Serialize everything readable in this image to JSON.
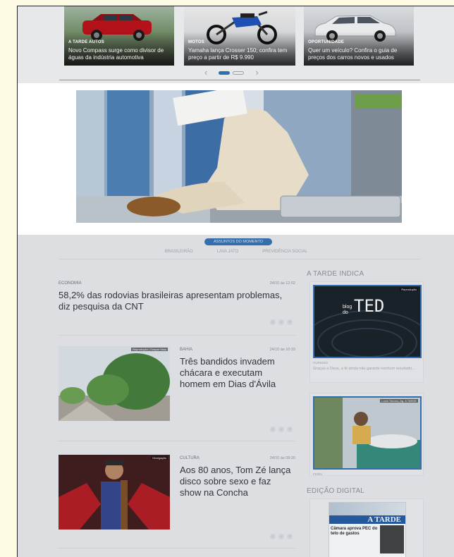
{
  "carousel": {
    "cards": [
      {
        "category": "A TARDE AUTOS",
        "title": "Novo Compass surge como divisor de águas da indústria automotiva"
      },
      {
        "category": "MOTOS",
        "title": "Yamaha lança Crosser 150; confira tem preço a partir de R$ 9.990"
      },
      {
        "category": "OPORTUNIDADE",
        "title": "Quer um veículo? Confira o guia de preços dos carros novos e usados"
      }
    ],
    "prev_icon": "chevron-left-icon",
    "next_icon": "chevron-right-icon"
  },
  "subjects": {
    "pill_label": "ASSUNTOS DO MOMENTO",
    "links": [
      "BRASILEIRÃO",
      "LAVA JATO",
      "PREVIDÊNCIA SOCIAL"
    ]
  },
  "news": [
    {
      "category": "ECONOMIA",
      "date": "24/10 às 12:02",
      "headline": "58,2% das rodovias brasileiras apresentam problemas, diz pesquisa da CNT"
    },
    {
      "category": "BAHIA",
      "date": "24/10 às 10:33",
      "headline": "Três bandidos invadem chácara e executam homem em Dias d'Ávila",
      "credit": "Reprodução | Gaspar Maia"
    },
    {
      "category": "CULTURA",
      "date": "24/10 às 09:20",
      "headline": "Aos 80 anos, Tom Zé lança disco sobre sexo e faz show na Concha",
      "credit": "Divulgação"
    }
  ],
  "sidebar": {
    "indica_title": "A TARDE INDICA",
    "indica_items": [
      {
        "credit": "Reprodução",
        "category": "CURIOSO",
        "text": "Graças a Deus, a fé ainda não garante nenhum resultado..."
      },
      {
        "credit": "Lúcio Távora | Ag. A TARDE",
        "category": "FEIRA"
      }
    ],
    "ted_logo_small": "blog do",
    "ted_logo_big": "TED",
    "edicao_title": "EDIÇÃO DIGITAL",
    "newspaper_name": "A TARDE",
    "newspaper_headline": "Câmara aprova PEC do teto de gastos"
  },
  "colors": {
    "accent": "#2f6fb0",
    "background": "#fdfbe3"
  }
}
